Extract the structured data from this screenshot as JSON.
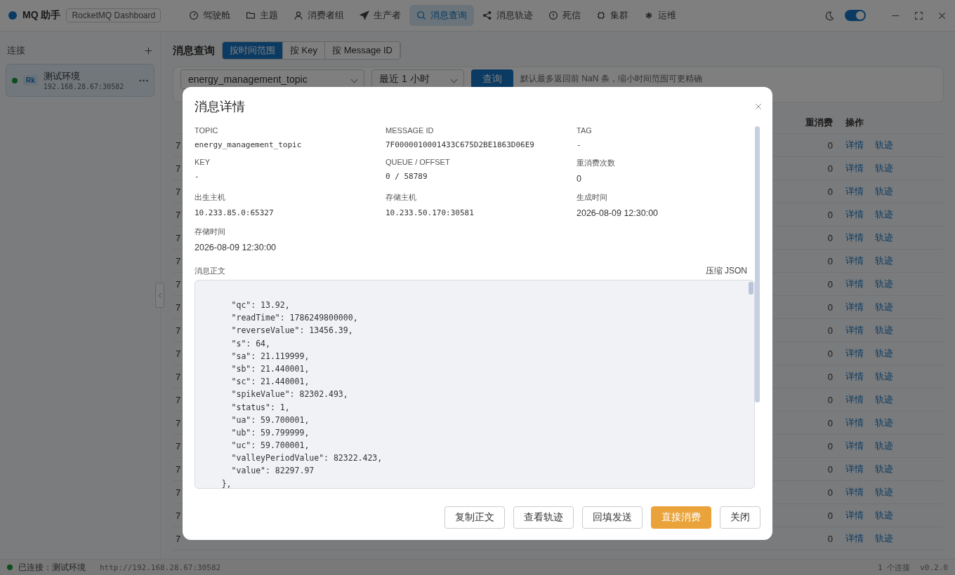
{
  "app": {
    "logo": "MQ 助手",
    "badge": "RocketMQ Dashboard"
  },
  "nav": [
    {
      "label": "驾驶舱",
      "selected": false
    },
    {
      "label": "主题",
      "selected": false
    },
    {
      "label": "消费者组",
      "selected": false
    },
    {
      "label": "生产者",
      "selected": false
    },
    {
      "label": "消息查询",
      "selected": true
    },
    {
      "label": "消息轨迹",
      "selected": false
    },
    {
      "label": "死信",
      "selected": false
    },
    {
      "label": "集群",
      "selected": false
    },
    {
      "label": "运维",
      "selected": false
    }
  ],
  "theme_toggle": {
    "on": true
  },
  "sidebar": {
    "title": "连接",
    "connections": [
      {
        "badge": "Rk",
        "name": "测试环境",
        "address": "192.168.28.67:30582",
        "selected": true,
        "online": true
      }
    ]
  },
  "page": {
    "title": "消息查询",
    "tabs": [
      {
        "label": "按时间范围",
        "selected": true
      },
      {
        "label": "按 Key",
        "selected": false
      },
      {
        "label": "按 Message ID",
        "selected": false
      }
    ],
    "topic_select": "energy_management_topic",
    "range_select": "最近 1 小时",
    "query_button": "查询",
    "hint": "默认最多返回前 NaN 条，缩小时间范围可更精确"
  },
  "table": {
    "columns": [
      "重消费",
      "操作"
    ],
    "rows": [
      {
        "column_1": "7",
        "retries": "0",
        "actions": [
          "详情",
          "轨迹"
        ]
      },
      {
        "column_1": "7",
        "retries": "0",
        "actions": [
          "详情",
          "轨迹"
        ]
      },
      {
        "column_1": "7",
        "retries": "0",
        "actions": [
          "详情",
          "轨迹"
        ]
      },
      {
        "column_1": "7",
        "retries": "0",
        "actions": [
          "详情",
          "轨迹"
        ]
      },
      {
        "column_1": "7",
        "retries": "0",
        "actions": [
          "详情",
          "轨迹"
        ]
      },
      {
        "column_1": "7",
        "retries": "0",
        "actions": [
          "详情",
          "轨迹"
        ]
      },
      {
        "column_1": "7",
        "retries": "0",
        "actions": [
          "详情",
          "轨迹"
        ]
      },
      {
        "column_1": "7",
        "retries": "0",
        "actions": [
          "详情",
          "轨迹"
        ]
      },
      {
        "column_1": "7",
        "retries": "0",
        "actions": [
          "详情",
          "轨迹"
        ]
      },
      {
        "column_1": "7",
        "retries": "0",
        "actions": [
          "详情",
          "轨迹"
        ]
      },
      {
        "column_1": "7",
        "retries": "0",
        "actions": [
          "详情",
          "轨迹"
        ]
      },
      {
        "column_1": "7",
        "retries": "0",
        "actions": [
          "详情",
          "轨迹"
        ]
      },
      {
        "column_1": "7",
        "retries": "0",
        "actions": [
          "详情",
          "轨迹"
        ]
      },
      {
        "column_1": "7",
        "retries": "0",
        "actions": [
          "详情",
          "轨迹"
        ]
      },
      {
        "column_1": "7",
        "retries": "0",
        "actions": [
          "详情",
          "轨迹"
        ]
      },
      {
        "column_1": "7",
        "retries": "0",
        "actions": [
          "详情",
          "轨迹"
        ]
      },
      {
        "column_1": "7",
        "retries": "0",
        "actions": [
          "详情",
          "轨迹"
        ]
      },
      {
        "column_1": "7",
        "retries": "0",
        "actions": [
          "详情",
          "轨迹"
        ]
      }
    ]
  },
  "dialog": {
    "title": "消息详情",
    "fields": [
      {
        "label": "TOPIC",
        "value": "energy_management_topic",
        "kind": "mono"
      },
      {
        "label": "MESSAGE ID",
        "value": "7F0000010001433C675D2BE1863D06E9",
        "kind": "mono"
      },
      {
        "label": "TAG",
        "value": "-",
        "kind": "mono"
      },
      {
        "label": "KEY",
        "value": "-",
        "kind": "mono"
      },
      {
        "label": "QUEUE / OFFSET",
        "value": "0 / 58789",
        "kind": "mono"
      },
      {
        "label": "重消费次数",
        "value": "0",
        "kind": "plain"
      },
      {
        "label": "出生主机",
        "value": "10.233.85.0:65327",
        "kind": "mono"
      },
      {
        "label": "存储主机",
        "value": "10.233.50.170:30581",
        "kind": "mono"
      },
      {
        "label": "生成时间",
        "value": "2026-08-09 12:30:00",
        "kind": "plain"
      },
      {
        "label": "存储时间",
        "value": "2026-08-09 12:30:00",
        "kind": "plain"
      }
    ],
    "body_label": "消息正文",
    "compress_link": "压缩 JSON",
    "body_lines": [
      "      \"qc\": 13.92,",
      "      \"readTime\": 1786249800000,",
      "      \"reverseValue\": 13456.39,",
      "      \"s\": 64,",
      "      \"sa\": 21.119999,",
      "      \"sb\": 21.440001,",
      "      \"sc\": 21.440001,",
      "      \"spikeValue\": 82302.493,",
      "      \"status\": 1,",
      "      \"ua\": 59.700001,",
      "      \"ub\": 59.799999,",
      "      \"uc\": 59.700001,",
      "      \"valleyPeriodValue\": 82322.423,",
      "      \"value\": 82297.97",
      "    },"
    ],
    "buttons": [
      {
        "label": "复制正文",
        "kind": "default"
      },
      {
        "label": "查看轨迹",
        "kind": "default"
      },
      {
        "label": "回填发送",
        "kind": "default"
      },
      {
        "label": "直接消费",
        "kind": "primary"
      },
      {
        "label": "关闭",
        "kind": "default"
      }
    ]
  },
  "status_bar": {
    "status": "已连接：测试环境",
    "url": "http://192.168.28.67:30582",
    "count": "1 个连接",
    "version": "v0.2.0",
    "connected": true
  }
}
